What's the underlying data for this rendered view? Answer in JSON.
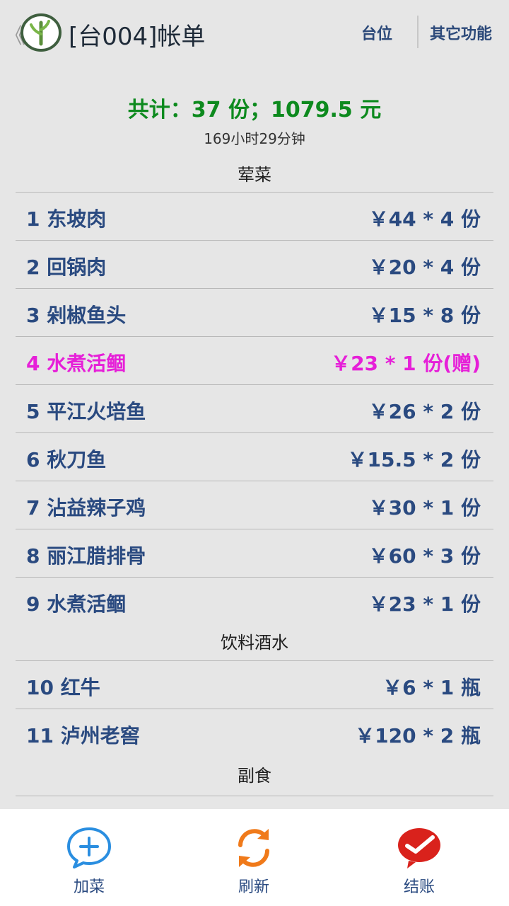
{
  "header": {
    "back": "《",
    "title": "[台004]帐单",
    "btn_table": "台位",
    "btn_more": "其它功能"
  },
  "summary": {
    "total": "共计：37 份；1079.5 元",
    "elapsed": "169小时29分钟"
  },
  "sections": [
    {
      "title": "荤菜",
      "items": [
        {
          "name": "1 东坡肉",
          "price": "￥44 * 4 份"
        },
        {
          "name": "2 回锅肉",
          "price": "￥20 * 4 份"
        },
        {
          "name": "3 剁椒鱼头",
          "price": "￥15 * 8 份"
        },
        {
          "name": "4 水煮活鲴",
          "price": "￥23 * 1 份(赠)",
          "gift": true
        },
        {
          "name": "5 平江火培鱼",
          "price": "￥26 * 2 份"
        },
        {
          "name": "6 秋刀鱼",
          "price": "￥15.5 * 2 份"
        },
        {
          "name": "7 沾益辣子鸡",
          "price": "￥30 * 1 份"
        },
        {
          "name": "8 丽江腊排骨",
          "price": "￥60 * 3 份"
        },
        {
          "name": "9 水煮活鲴",
          "price": "￥23 * 1 份"
        }
      ]
    },
    {
      "title": "饮料酒水",
      "items": [
        {
          "name": "10 红牛",
          "price": "￥6 * 1 瓶"
        },
        {
          "name": "11 泸州老窖",
          "price": "￥120 * 2 瓶"
        }
      ]
    },
    {
      "title": "副食",
      "items": []
    }
  ],
  "tabs": [
    {
      "label": "加菜",
      "icon": "add-bubble-icon"
    },
    {
      "label": "刷新",
      "icon": "refresh-icon"
    },
    {
      "label": "结账",
      "icon": "checkout-check-icon"
    }
  ],
  "colors": {
    "primary": "#2a4a80",
    "total": "#0d8a1e",
    "gift": "#e620d8",
    "refresh": "#f07a1a",
    "checkout": "#d9221c",
    "add": "#2a8ee0"
  }
}
